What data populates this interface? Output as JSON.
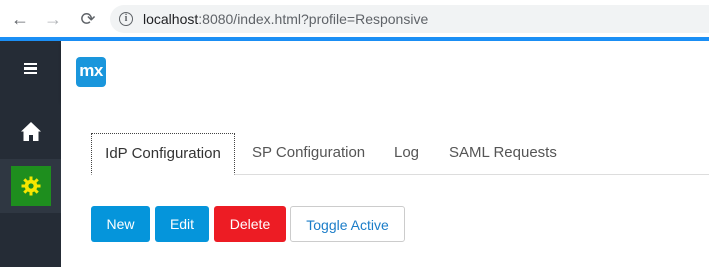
{
  "browser": {
    "url_host": "localhost",
    "url_rest": ":8080/index.html?profile=Responsive",
    "back_glyph": "←",
    "forward_glyph": "→",
    "reload_glyph": "⟳",
    "info_glyph": "i",
    "icons": [
      "back-arrow-icon",
      "forward-arrow-icon",
      "reload-icon",
      "info-icon"
    ]
  },
  "sidebar": {
    "items": [
      {
        "icon": "hamburger-menu-icon"
      },
      {
        "icon": "home-icon"
      },
      {
        "icon": "gear-icon",
        "active": true
      }
    ]
  },
  "header": {
    "logo_text": "mx"
  },
  "tabs": [
    {
      "label": "IdP Configuration",
      "active": true
    },
    {
      "label": "SP Configuration"
    },
    {
      "label": "Log"
    },
    {
      "label": "SAML Requests"
    }
  ],
  "buttons": {
    "new": "New",
    "edit": "Edit",
    "delete": "Delete",
    "toggle": "Toggle Active"
  },
  "colors": {
    "accent_blue": "#0595db",
    "danger_red": "#ed1c24",
    "sidebar_bg": "#252c36",
    "settings_green": "#1e8e1e",
    "gear_yellow": "#f5e600",
    "top_line": "#1b8ff5"
  }
}
